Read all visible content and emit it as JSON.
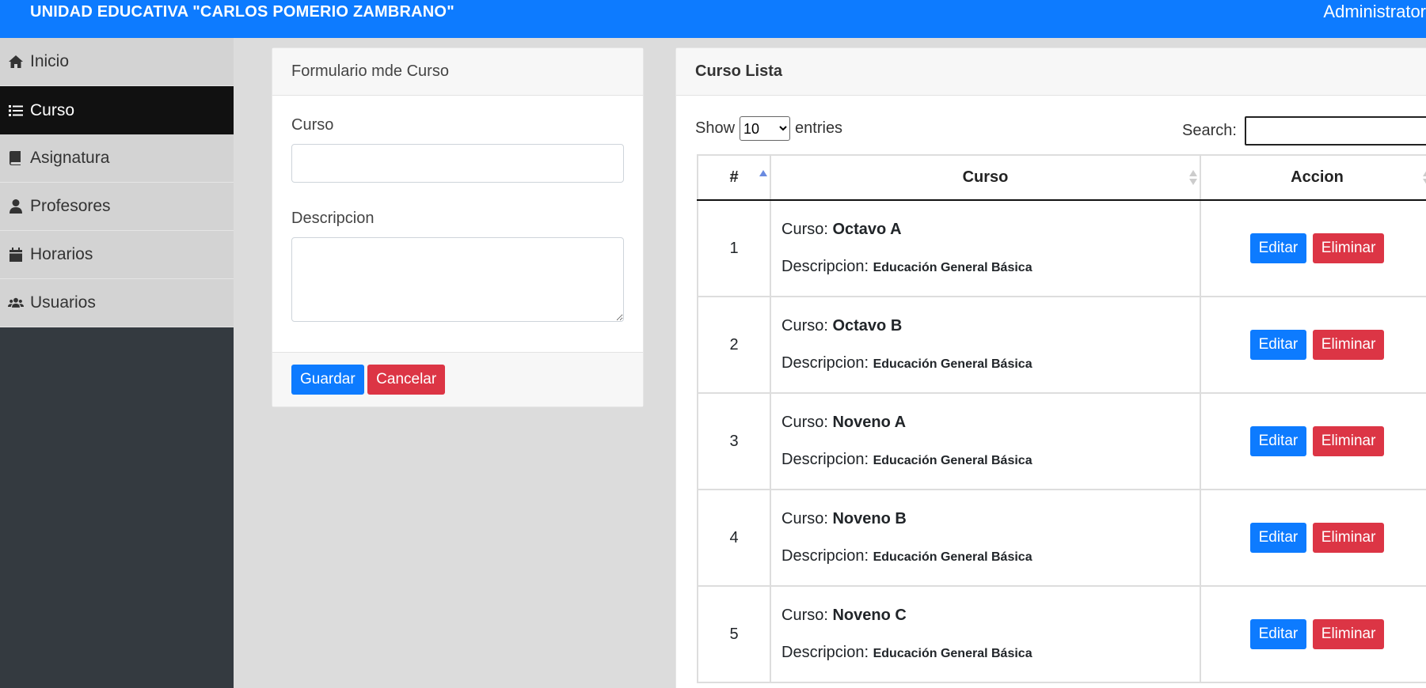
{
  "header": {
    "title": "UNIDAD EDUCATIVA \"CARLOS POMERIO ZAMBRANO\"",
    "user": "Administrator"
  },
  "sidebar": {
    "items": [
      {
        "label": "Inicio",
        "icon": "home-icon"
      },
      {
        "label": "Curso",
        "icon": "list-icon",
        "active": true
      },
      {
        "label": "Asignatura",
        "icon": "book-icon"
      },
      {
        "label": "Profesores",
        "icon": "user-tie-icon"
      },
      {
        "label": "Horarios",
        "icon": "calendar-icon"
      },
      {
        "label": "Usuarios",
        "icon": "users-icon"
      }
    ]
  },
  "form": {
    "title": "Formulario mde Curso",
    "curso_label": "Curso",
    "curso_value": "",
    "descripcion_label": "Descripcion",
    "descripcion_value": "",
    "save_label": "Guardar",
    "cancel_label": "Cancelar"
  },
  "list": {
    "title": "Curso Lista",
    "show_label": "Show",
    "entries_value": "10",
    "entries_label": "entries",
    "search_label": "Search:",
    "search_value": "",
    "columns": [
      "#",
      "Curso",
      "Accion"
    ],
    "curso_prefix": "Curso:",
    "descripcion_prefix": "Descripcion:",
    "edit_label": "Editar",
    "delete_label": "Eliminar",
    "rows": [
      {
        "num": "1",
        "curso": "Octavo A",
        "descripcion": "Educación General Básica"
      },
      {
        "num": "2",
        "curso": "Octavo B",
        "descripcion": "Educación General Básica"
      },
      {
        "num": "3",
        "curso": "Noveno A",
        "descripcion": "Educación General Básica"
      },
      {
        "num": "4",
        "curso": "Noveno B",
        "descripcion": "Educación General Básica"
      },
      {
        "num": "5",
        "curso": "Noveno C",
        "descripcion": "Educación General Básica"
      }
    ]
  },
  "colors": {
    "primary": "#0d7bff",
    "danger": "#dc3545",
    "sidebar_dark": "#343a40",
    "active_nav": "#111111"
  }
}
